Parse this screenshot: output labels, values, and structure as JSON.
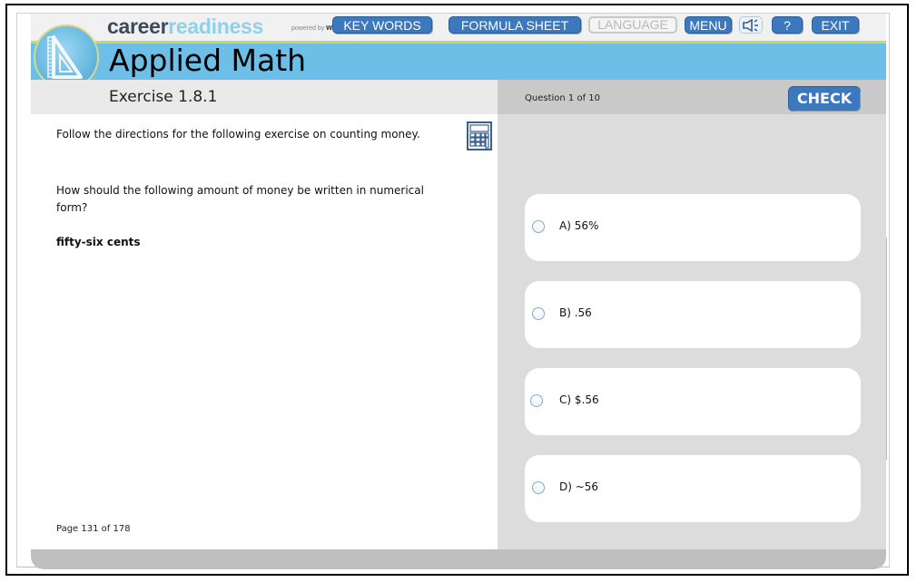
{
  "brand": {
    "part1": "career",
    "part2": "readiness",
    "powered_by": "powered by",
    "powered_brand": "win"
  },
  "toolbar": {
    "key_words": "KEY WORDS",
    "formula_sheet": "FORMULA SHEET",
    "language": "LANGUAGE",
    "menu": "MENU",
    "audio_icon": "≤",
    "help": "?",
    "exit": "EXIT"
  },
  "header": {
    "app_title": "Applied Math",
    "exercise": "Exercise 1.8.1",
    "question_count": "Question 1 of 10",
    "check_label": "CHECK"
  },
  "content": {
    "directions": "Follow the directions for the following exercise on counting money.",
    "question": "How should the following amount of money be written in numerical form?",
    "amount": "fifty-six cents",
    "page": "Page 131 of 178"
  },
  "choices": [
    {
      "label": "A) 56%",
      "selected": false
    },
    {
      "label": "B) .56",
      "selected": false
    },
    {
      "label": "C) $.56",
      "selected": false
    },
    {
      "label": "D) ~56",
      "selected": false
    }
  ],
  "colors": {
    "accent_blue": "#3b78bd",
    "title_bar": "#6dbfe8",
    "brand_dark": "#3d4a5c",
    "brand_light": "#8fd0ea",
    "divider_green": "#c5d86d"
  }
}
